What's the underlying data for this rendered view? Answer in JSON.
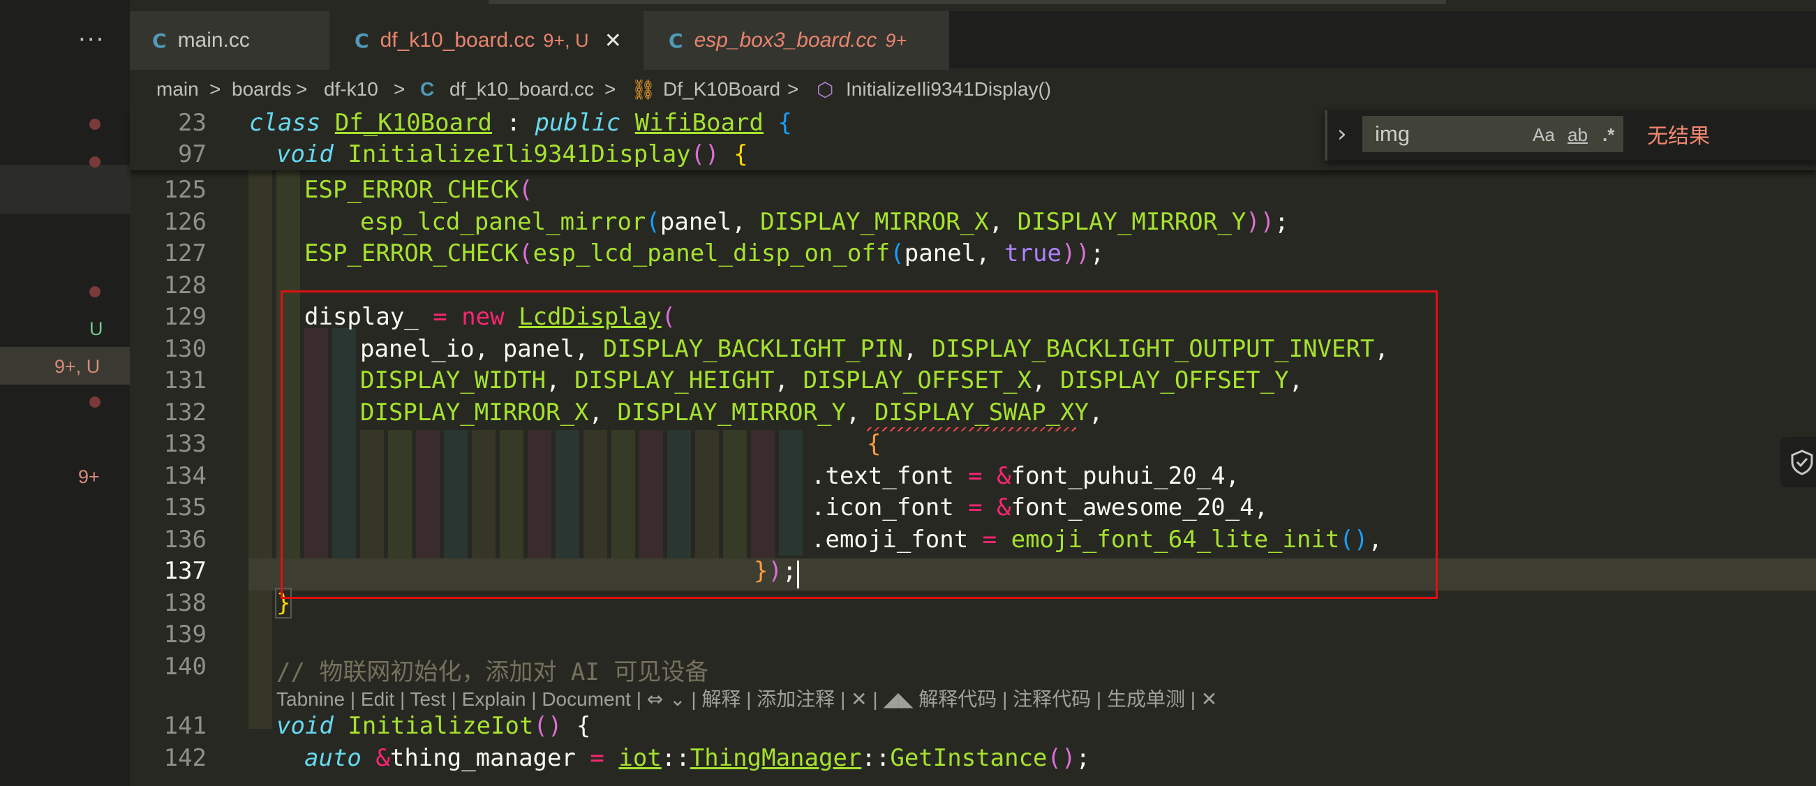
{
  "sidebar": {
    "more_label": "···",
    "scm_labels": [
      {
        "text": "U",
        "color": "#73c991"
      },
      {
        "text": "9+, U",
        "color": "#d78a7a"
      },
      {
        "text": "9+",
        "color": "#d78a7a"
      }
    ]
  },
  "tabs": [
    {
      "name": "main.cc",
      "status": "",
      "color": "#c8c8c0",
      "italic": false,
      "active": false
    },
    {
      "name": "df_k10_board.cc",
      "status": "9+, U",
      "color": "#e8846e",
      "italic": false,
      "active": true,
      "close": "✕"
    },
    {
      "name": "esp_box3_board.cc",
      "status": "9+",
      "color": "#e8846e",
      "italic": true,
      "active": false
    }
  ],
  "breadcrumbs": {
    "items": [
      "main",
      "boards",
      "df-k10",
      "df_k10_board.cc",
      "Df_K10Board",
      "InitializeIli9341Display()"
    ],
    "separator": ">"
  },
  "find_widget": {
    "query": "img",
    "match_case": "Aa",
    "whole_word": "ab",
    "regex": ".*",
    "result": "无结果"
  },
  "editor": {
    "sticky": [
      {
        "num": "23"
      },
      {
        "num": "97"
      }
    ],
    "lines": [
      {
        "num": "125"
      },
      {
        "num": "126"
      },
      {
        "num": "127"
      },
      {
        "num": "128"
      },
      {
        "num": "129"
      },
      {
        "num": "130"
      },
      {
        "num": "131"
      },
      {
        "num": "132"
      },
      {
        "num": "133"
      },
      {
        "num": "134"
      },
      {
        "num": "135"
      },
      {
        "num": "136"
      },
      {
        "num": "137"
      },
      {
        "num": "138"
      },
      {
        "num": "139"
      },
      {
        "num": "140"
      },
      {
        "num": "141"
      },
      {
        "num": "142"
      }
    ],
    "current_line": "137"
  },
  "code": {
    "l23": {
      "kw": "class",
      "cls": "Df_K10Board",
      "colon": " : ",
      "kw2": "public",
      "base": "WifiBoard",
      "brace": " {"
    },
    "l97": {
      "kw": "void",
      "fn": "InitializeIli9341Display",
      "parens": "()",
      "brace": " {"
    },
    "l125": {
      "fn": "ESP_ERROR_CHECK",
      "open": "("
    },
    "l126": {
      "fn": "esp_lcd_panel_mirror",
      "open": "(",
      "a1": "panel, ",
      "c1": "DISPLAY_MIRROR_X",
      "s1": ", ",
      "c2": "DISPLAY_MIRROR_Y",
      "close": "))",
      "end": ";"
    },
    "l127": {
      "fn": "ESP_ERROR_CHECK",
      "open": "(",
      "fn2": "esp_lcd_panel_disp_on_off",
      "open2": "(",
      "a1": "panel, ",
      "b": "true",
      "close": "))",
      "end": ";"
    },
    "l129": {
      "var": "display_ ",
      "eq": "= ",
      "kw": "new ",
      "cls": "LcdDisplay",
      "open": "("
    },
    "l130": {
      "a": "panel_io, panel, ",
      "c1": "DISPLAY_BACKLIGHT_PIN",
      "s": ", ",
      "c2": "DISPLAY_BACKLIGHT_OUTPUT_INVERT",
      "end": ","
    },
    "l131": {
      "c1": "DISPLAY_WIDTH",
      "c2": "DISPLAY_HEIGHT",
      "c3": "DISPLAY_OFFSET_X",
      "c4": "DISPLAY_OFFSET_Y",
      "s": ", ",
      "end": ","
    },
    "l132": {
      "c1": "DISPLAY_MIRROR_X",
      "c2": "DISPLAY_MIRROR_Y",
      "c3": "DISPLAY_SWAP_XY",
      "s": ", ",
      "end": ","
    },
    "l133": {
      "brace": "{"
    },
    "l134": {
      "field": ".text_font ",
      "eq": "= ",
      "amp": "&",
      "val": "font_puhui_20_4",
      "end": ","
    },
    "l135": {
      "field": ".icon_font ",
      "eq": "= ",
      "amp": "&",
      "val": "font_awesome_20_4",
      "end": ","
    },
    "l136": {
      "field": ".emoji_font ",
      "eq": "= ",
      "fn": "emoji_font_64_lite_init",
      "parens": "()",
      "end": ","
    },
    "l137": {
      "brace": "}",
      "paren": ")",
      "end": ";"
    },
    "l138": {
      "brace": "}"
    },
    "l140": {
      "comment": "// 物联网初始化，添加对 AI 可见设备"
    },
    "l141": {
      "kw": "void",
      "fn": "InitializeIot",
      "parens": "()",
      "brace": " {"
    },
    "l142": {
      "kw": "auto",
      "amp": " &",
      "var": "thing_manager ",
      "eq": "= ",
      "ns": "iot",
      "sep": "::",
      "cls": "ThingManager",
      "sep2": "::",
      "fn": "GetInstance",
      "parens": "()",
      "end": ";"
    }
  },
  "codelens": {
    "text": "Tabnine | Edit | Test | Explain | Document | ",
    "text2": " | 解释 | 添加注释 | ",
    "close1": "✕",
    "sep": " | ",
    "text3": " 解释代码 | 注释代码 | 生成单测 | ",
    "close2": "✕"
  }
}
